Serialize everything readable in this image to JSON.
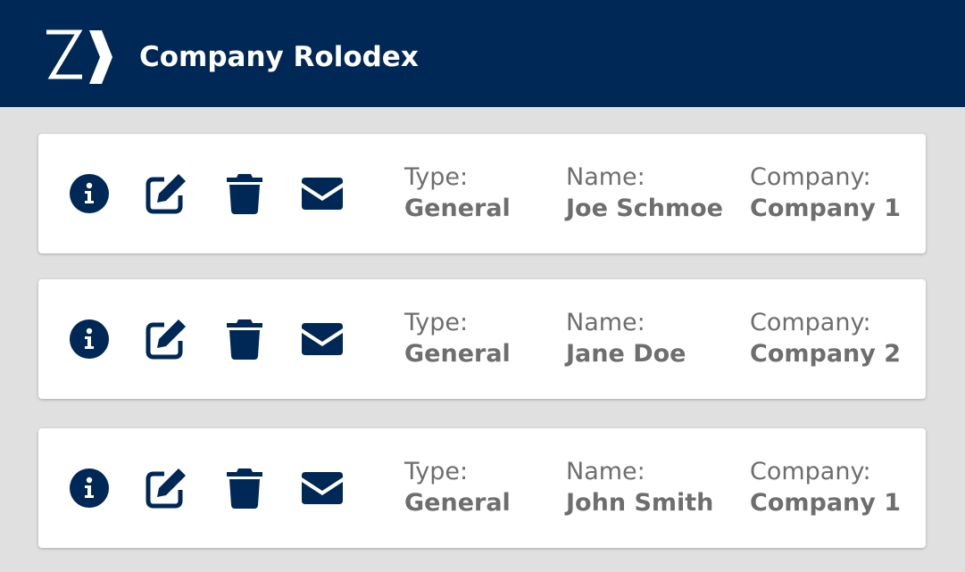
{
  "header": {
    "title": "Company Rolodex",
    "logo_icon": "zeiss-style-logo-icon",
    "background": "#002856"
  },
  "colors": {
    "icon": "#002856",
    "text": "#6e6e6e",
    "card": "#ffffff",
    "page": "#e0e0e0"
  },
  "field_labels": {
    "type": "Type:",
    "name": "Name:",
    "company": "Company:"
  },
  "icons": [
    "info-icon",
    "edit-icon",
    "trash-icon",
    "mail-icon"
  ],
  "contacts": [
    {
      "type": "General",
      "name": "Joe Schmoe",
      "company": "Company 1"
    },
    {
      "type": "General",
      "name": "Jane Doe",
      "company": "Company 2"
    },
    {
      "type": "General",
      "name": "John Smith",
      "company": "Company 1"
    }
  ]
}
